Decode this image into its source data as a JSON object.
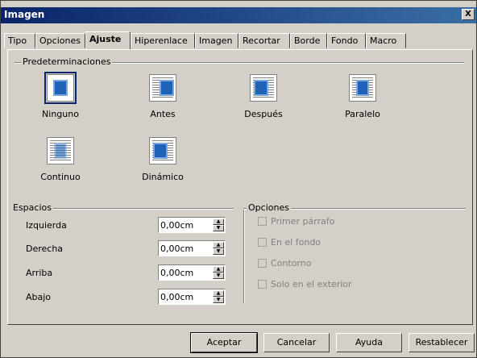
{
  "window": {
    "title": "Imagen",
    "close_label": "X"
  },
  "tabs": [
    "Tipo",
    "Opciones",
    "Ajuste",
    "Hiperenlace",
    "Imagen",
    "Recortar",
    "Borde",
    "Fondo",
    "Macro"
  ],
  "active_tab": "Ajuste",
  "presets": {
    "title": "Predeterminaciones",
    "items": [
      {
        "name": "preset-ninguno",
        "label": "Ninguno",
        "selected": true
      },
      {
        "name": "preset-antes",
        "label": "Antes",
        "selected": false
      },
      {
        "name": "preset-despues",
        "label": "Después",
        "selected": false
      },
      {
        "name": "preset-paralelo",
        "label": "Paralelo",
        "selected": false
      },
      {
        "name": "preset-continuo",
        "label": "Continuo",
        "selected": false
      },
      {
        "name": "preset-dinamico",
        "label": "Dinámico",
        "selected": false
      }
    ]
  },
  "spacing": {
    "title": "Espacios",
    "fields": [
      {
        "label": "Izquierda",
        "value": "0,00cm"
      },
      {
        "label": "Derecha",
        "value": "0,00cm"
      },
      {
        "label": "Arriba",
        "value": "0,00cm"
      },
      {
        "label": "Abajo",
        "value": "0,00cm"
      }
    ]
  },
  "options": {
    "title": "Opciones",
    "checkboxes": [
      {
        "label": "Primer párrafo",
        "checked": false,
        "enabled": false
      },
      {
        "label": "En el fondo",
        "checked": false,
        "enabled": false
      },
      {
        "label": "Contorno",
        "checked": false,
        "enabled": false
      },
      {
        "label": "Solo en el exterior",
        "checked": false,
        "enabled": false
      }
    ]
  },
  "buttons": {
    "ok": "Aceptar",
    "cancel": "Cancelar",
    "help": "Ayuda",
    "reset": "Restablecer"
  },
  "colors": {
    "titlebar": "#0a246a",
    "face": "#d4d0c8"
  }
}
